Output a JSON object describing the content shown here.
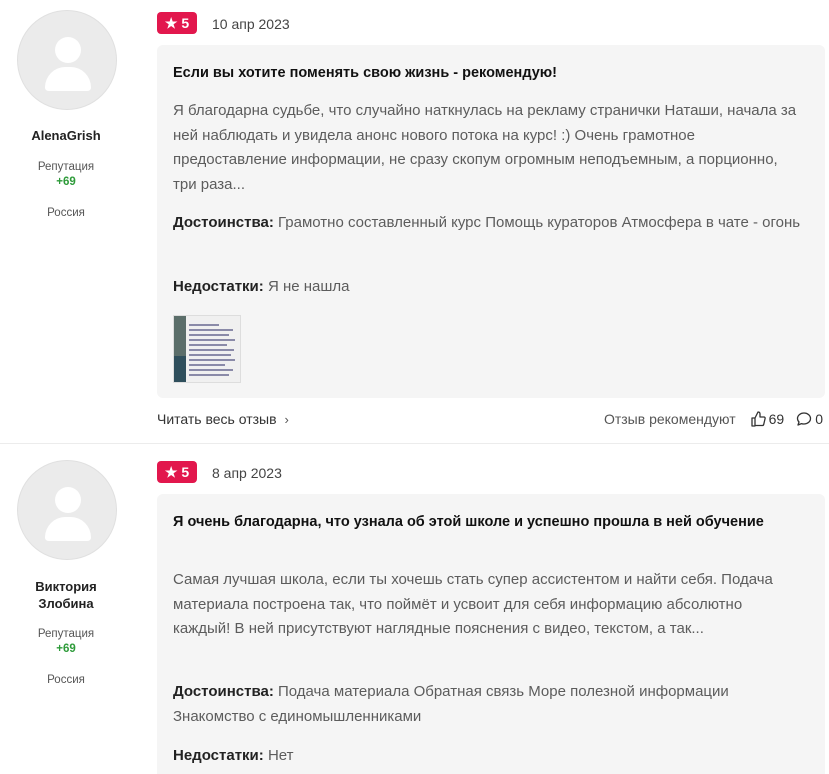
{
  "reviews": [
    {
      "author": "AlenaGrish",
      "reputation_label": "Репутация",
      "reputation_value": "+69",
      "country": "Россия",
      "rating": "5",
      "date": "10 апр 2023",
      "title": "Если вы хотите поменять свою жизнь - рекомендую!",
      "text": "Я благодарна судьбе, что случайно наткнулась на рекламу странички Наташи, начала за ней наблюдать и увидела анонс нового потока на курс! :) Очень грамотное предоставление информации, не сразу скопум огромным неподъемным, а порционно, три раза...",
      "pros_label": "Достоинства:",
      "pros": "Грамотно составленный курс Помощь кураторов Атмосфера в чате - огонь",
      "cons_label": "Недостатки:",
      "cons": "Я не нашла",
      "read_more": "Читать весь отзыв",
      "recommend_label": "Отзыв рекомендуют",
      "likes": "69",
      "comments": "0"
    },
    {
      "author": "Виктория Злобина",
      "reputation_label": "Репутация",
      "reputation_value": "+69",
      "country": "Россия",
      "rating": "5",
      "date": "8 апр 2023",
      "title": "Я очень благодарна, что узнала об этой школе и успешно прошла в ней обучение",
      "text": "Самая лучшая школа, если ты хочешь стать супер ассистентом и найти себя. Подача материала построена так, что поймёт и усвоит для себя информацию абсолютно каждый! В ней присутствуют наглядные пояснения с видео, текстом, а так...",
      "pros_label": "Достоинства:",
      "pros": "Подача материала Обратная связь Море полезной информации Знакомство с единомышленниками",
      "cons_label": "Недостатки:",
      "cons": "Нет"
    }
  ],
  "colors": {
    "rating_badge": "#e2174d",
    "reputation": "#2e9b3a",
    "card_bg": "#f5f5f5"
  },
  "icons": [
    "star-icon",
    "chevron-right-icon",
    "thumbs-up-icon",
    "comment-icon",
    "avatar-placeholder-icon"
  ]
}
